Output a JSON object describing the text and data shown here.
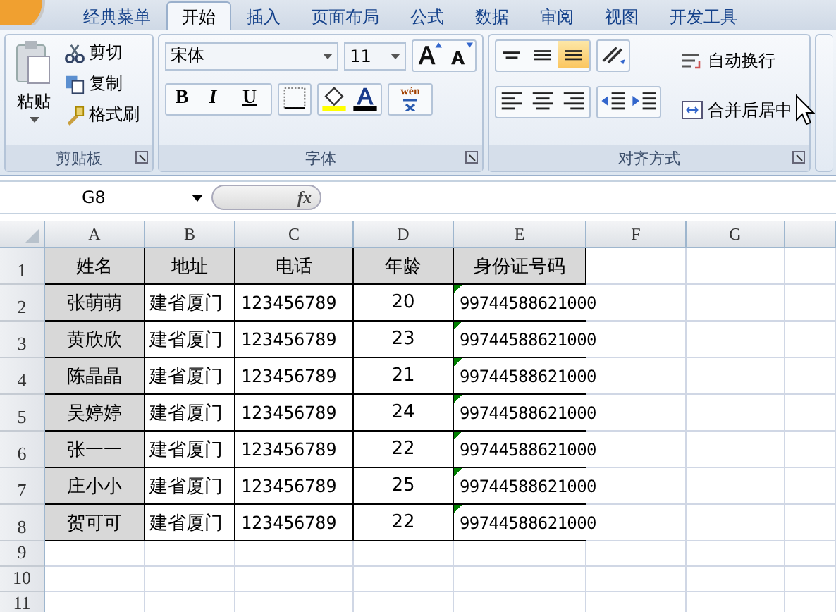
{
  "tabs": [
    {
      "label": "经典菜单",
      "selected": false
    },
    {
      "label": "开始",
      "selected": true
    },
    {
      "label": "插入",
      "selected": false
    },
    {
      "label": "页面布局",
      "selected": false
    },
    {
      "label": "公式",
      "selected": false
    },
    {
      "label": "数据",
      "selected": false
    },
    {
      "label": "审阅",
      "selected": false
    },
    {
      "label": "视图",
      "selected": false
    },
    {
      "label": "开发工具",
      "selected": false
    }
  ],
  "clipboard": {
    "title": "剪贴板",
    "paste": "粘贴",
    "cut": "剪切",
    "copy": "复制",
    "format_painter": "格式刷"
  },
  "font": {
    "title": "字体",
    "family": "宋体",
    "size": "11",
    "bold": "B",
    "italic": "I",
    "underline": "U",
    "phonetic": "wén"
  },
  "alignment": {
    "title": "对齐方式",
    "vertical": [
      {
        "kind": "top",
        "selected": false
      },
      {
        "kind": "middle",
        "selected": false
      },
      {
        "kind": "bottom",
        "selected": true
      }
    ],
    "wrap_text": "自动换行",
    "merge_center": "合并后居中"
  },
  "formula_bar": {
    "name_box": "G8",
    "function_label": "fx"
  },
  "sheet": {
    "columns": [
      "A",
      "B",
      "C",
      "D",
      "E",
      "F",
      "G"
    ],
    "header": {
      "number": "1",
      "cells": [
        "姓名",
        "地址",
        "电话",
        "年龄",
        "身份证号码"
      ]
    },
    "rows": [
      {
        "number": "2",
        "flag": true,
        "cells": [
          "张萌萌",
          "建省厦门",
          "123456789",
          "20",
          "99744588621000"
        ]
      },
      {
        "number": "3",
        "flag": true,
        "cells": [
          "黄欣欣",
          "建省厦门",
          "123456789",
          "23",
          "99744588621000"
        ]
      },
      {
        "number": "4",
        "flag": true,
        "cells": [
          "陈晶晶",
          "建省厦门",
          "123456789",
          "21",
          "99744588621000"
        ]
      },
      {
        "number": "5",
        "flag": true,
        "cells": [
          "吴婷婷",
          "建省厦门",
          "123456789",
          "24",
          "99744588621000"
        ]
      },
      {
        "number": "6",
        "flag": true,
        "cells": [
          "张一一",
          "建省厦门",
          "123456789",
          "22",
          "99744588621000"
        ]
      },
      {
        "number": "7",
        "flag": true,
        "cells": [
          "庄小小",
          "建省厦门",
          "123456789",
          "25",
          "99744588621000"
        ]
      },
      {
        "number": "8",
        "flag": true,
        "cells": [
          "贺可可",
          "建省厦门",
          "123456789",
          "22",
          "99744588621000"
        ]
      }
    ],
    "empty_rows": [
      "9",
      "10",
      "11"
    ]
  }
}
